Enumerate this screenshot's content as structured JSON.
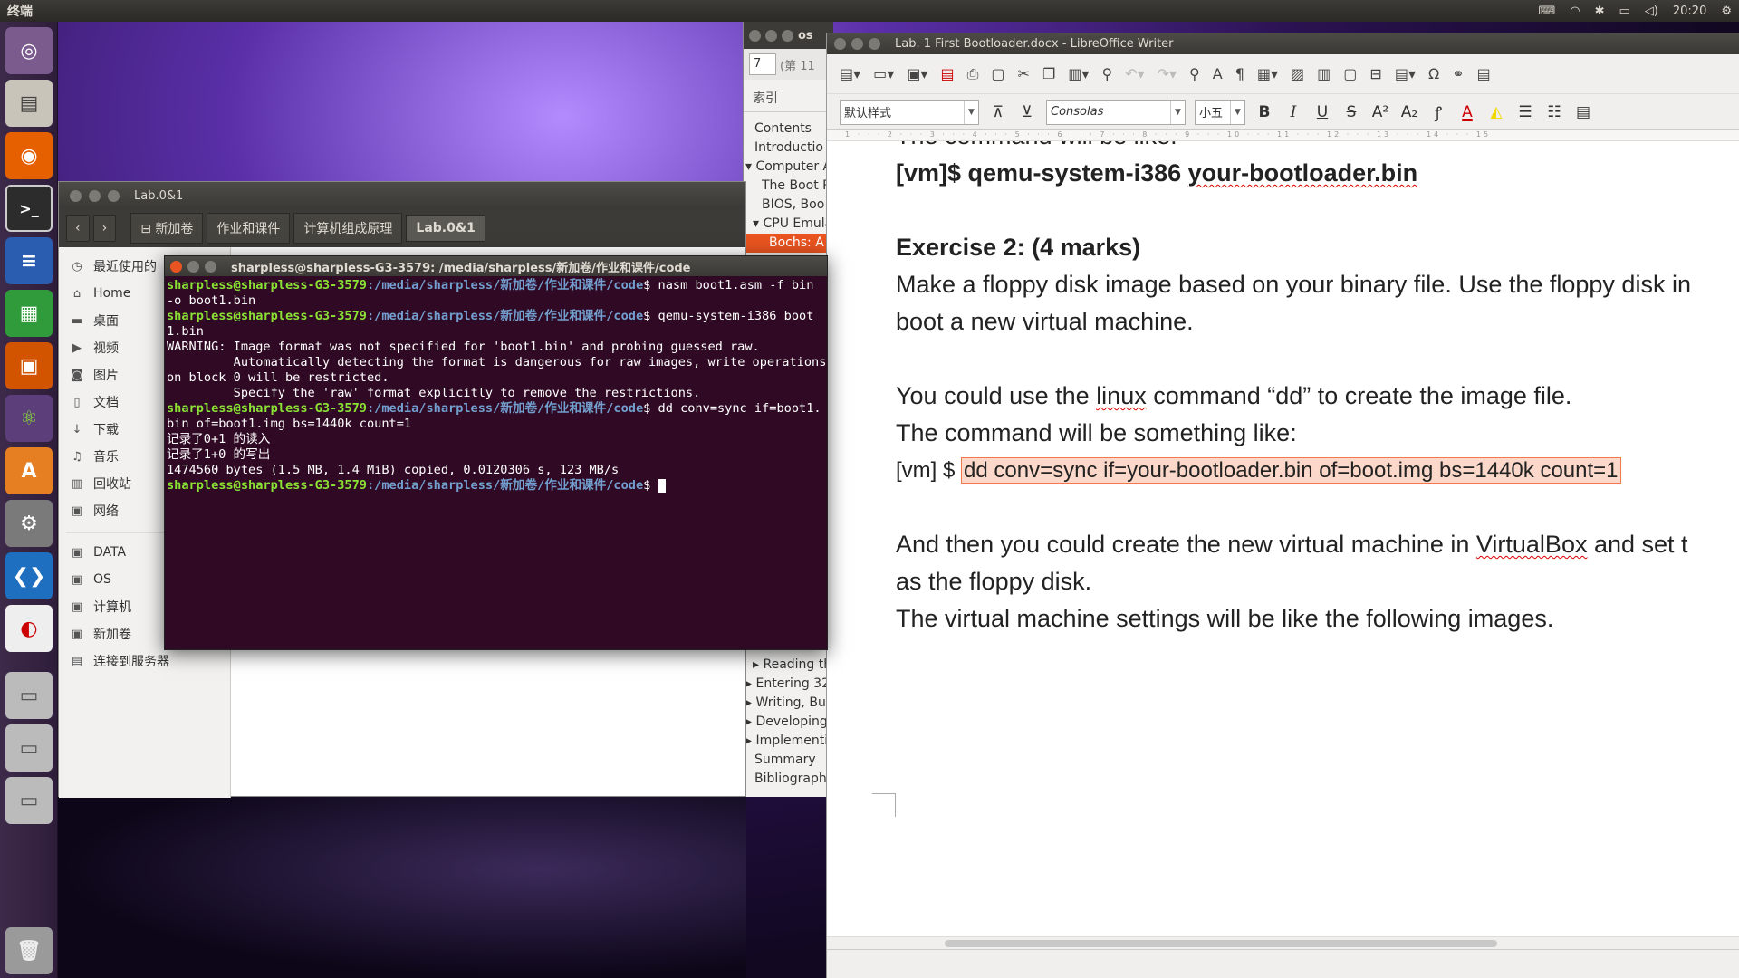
{
  "topbar": {
    "title": "终端",
    "clock": "20:20"
  },
  "launcher": [
    "dash",
    "files",
    "firefox",
    "terminal",
    "writer",
    "calc",
    "impress",
    "atom",
    "software-center",
    "settings",
    "vscode",
    "anbox",
    "disk1",
    "disk2",
    "disk3",
    "trash"
  ],
  "files": {
    "title": "Lab.0&1",
    "breadcrumbs": [
      "新加卷",
      "作业和课件",
      "计算机组成原理",
      "Lab.0&1"
    ],
    "sidebar": [
      {
        "icon": "clock-icon",
        "label": "最近使用的"
      },
      {
        "icon": "home-icon",
        "label": "Home"
      },
      {
        "icon": "folder-icon",
        "label": "桌面"
      },
      {
        "icon": "video-icon",
        "label": "视频"
      },
      {
        "icon": "camera-icon",
        "label": "图片"
      },
      {
        "icon": "document-icon",
        "label": "文档"
      },
      {
        "icon": "download-icon",
        "label": "下载"
      },
      {
        "icon": "music-icon",
        "label": "音乐"
      },
      {
        "icon": "trash-icon",
        "label": "回收站"
      },
      {
        "icon": "network-icon",
        "label": "网络"
      }
    ],
    "drives": [
      {
        "icon": "drive-icon",
        "label": "DATA"
      },
      {
        "icon": "drive-icon",
        "label": "OS"
      },
      {
        "icon": "computer-icon",
        "label": "计算机"
      },
      {
        "icon": "drive-icon",
        "label": "新加卷"
      },
      {
        "icon": "server-icon",
        "label": "连接到服务器"
      }
    ]
  },
  "terminal": {
    "title": "sharpless@sharpless-G3-3579: /media/sharpless/新加卷/作业和课件/code",
    "user": "sharpless@sharpless-G3-3579",
    "path": ":/media/sharpless/新加卷/作业和课件/code",
    "cmd1": "$ nasm boot1.asm -f bin -o boot1.bin",
    "cmd2": "$ qemu-system-i386 boot1.bin",
    "warn1": "WARNING: Image format was not specified for 'boot1.bin' and probing guessed raw.",
    "warn2": "         Automatically detecting the format is dangerous for raw images, write operations on block 0 will be restricted.",
    "warn3": "         Specify the 'raw' format explicitly to remove the restrictions.",
    "cmd3": "$ dd conv=sync if=boot1.bin of=boot1.img bs=1440k count=1",
    "out1": "记录了0+1 的读入",
    "out2": "记录了1+0 的写出",
    "out3": "1474560 bytes (1.5 MB, 1.4 MiB) copied, 0.0120306 s, 123 MB/s",
    "prompt_end": "$ "
  },
  "pdf": {
    "title": "os",
    "page_input": "7",
    "page_of": "(第 11",
    "index_label": "索引",
    "toc": [
      "Contents",
      "Introductio",
      "Computer A",
      "The Boot P",
      "BIOS, Boo",
      "CPU Emula",
      "Bochs: A"
    ],
    "toc2": [
      "Reading th",
      "Entering 32",
      "Writing, Bu",
      "Developing",
      "Implementi",
      "Summary",
      "Bibliograph"
    ]
  },
  "writer": {
    "title": "Lab. 1 First Bootloader.docx - LibreOffice Writer",
    "style": "默认样式",
    "font": "Consolas",
    "size": "小五",
    "ruler": "1 · · · 2 · · · 3 · · · 4 · · · 5 · · · 6 · · · 7 · · · 8 · · · 9 · · · 10 · · · 11 · · · 12 · · · 13 · · · 14 · · · 15",
    "l1": "The command will be like:",
    "l2a": "[vm]$ qemu-system-i386 ",
    "l2b": "your-bootloader.bin",
    "l3": "Exercise 2: (4 marks)",
    "l4": "Make a floppy disk image based on your binary file. Use the floppy disk in",
    "l5": "boot a new virtual machine.",
    "l6a": "You could use the ",
    "l6b": "linux",
    "l6c": " command “dd” to create the image file.",
    "l7": "The command will be something like:",
    "l8a": "[vm] $ ",
    "l8b": "dd conv=sync if=your-bootloader.bin of=boot.img bs=1440k count=1",
    "l9a": "And then you could create the new virtual machine in ",
    "l9b": "VirtualBox",
    "l9c": " and set t",
    "l10": "as the floppy disk.",
    "l11": "The virtual machine settings will be like the following images."
  }
}
